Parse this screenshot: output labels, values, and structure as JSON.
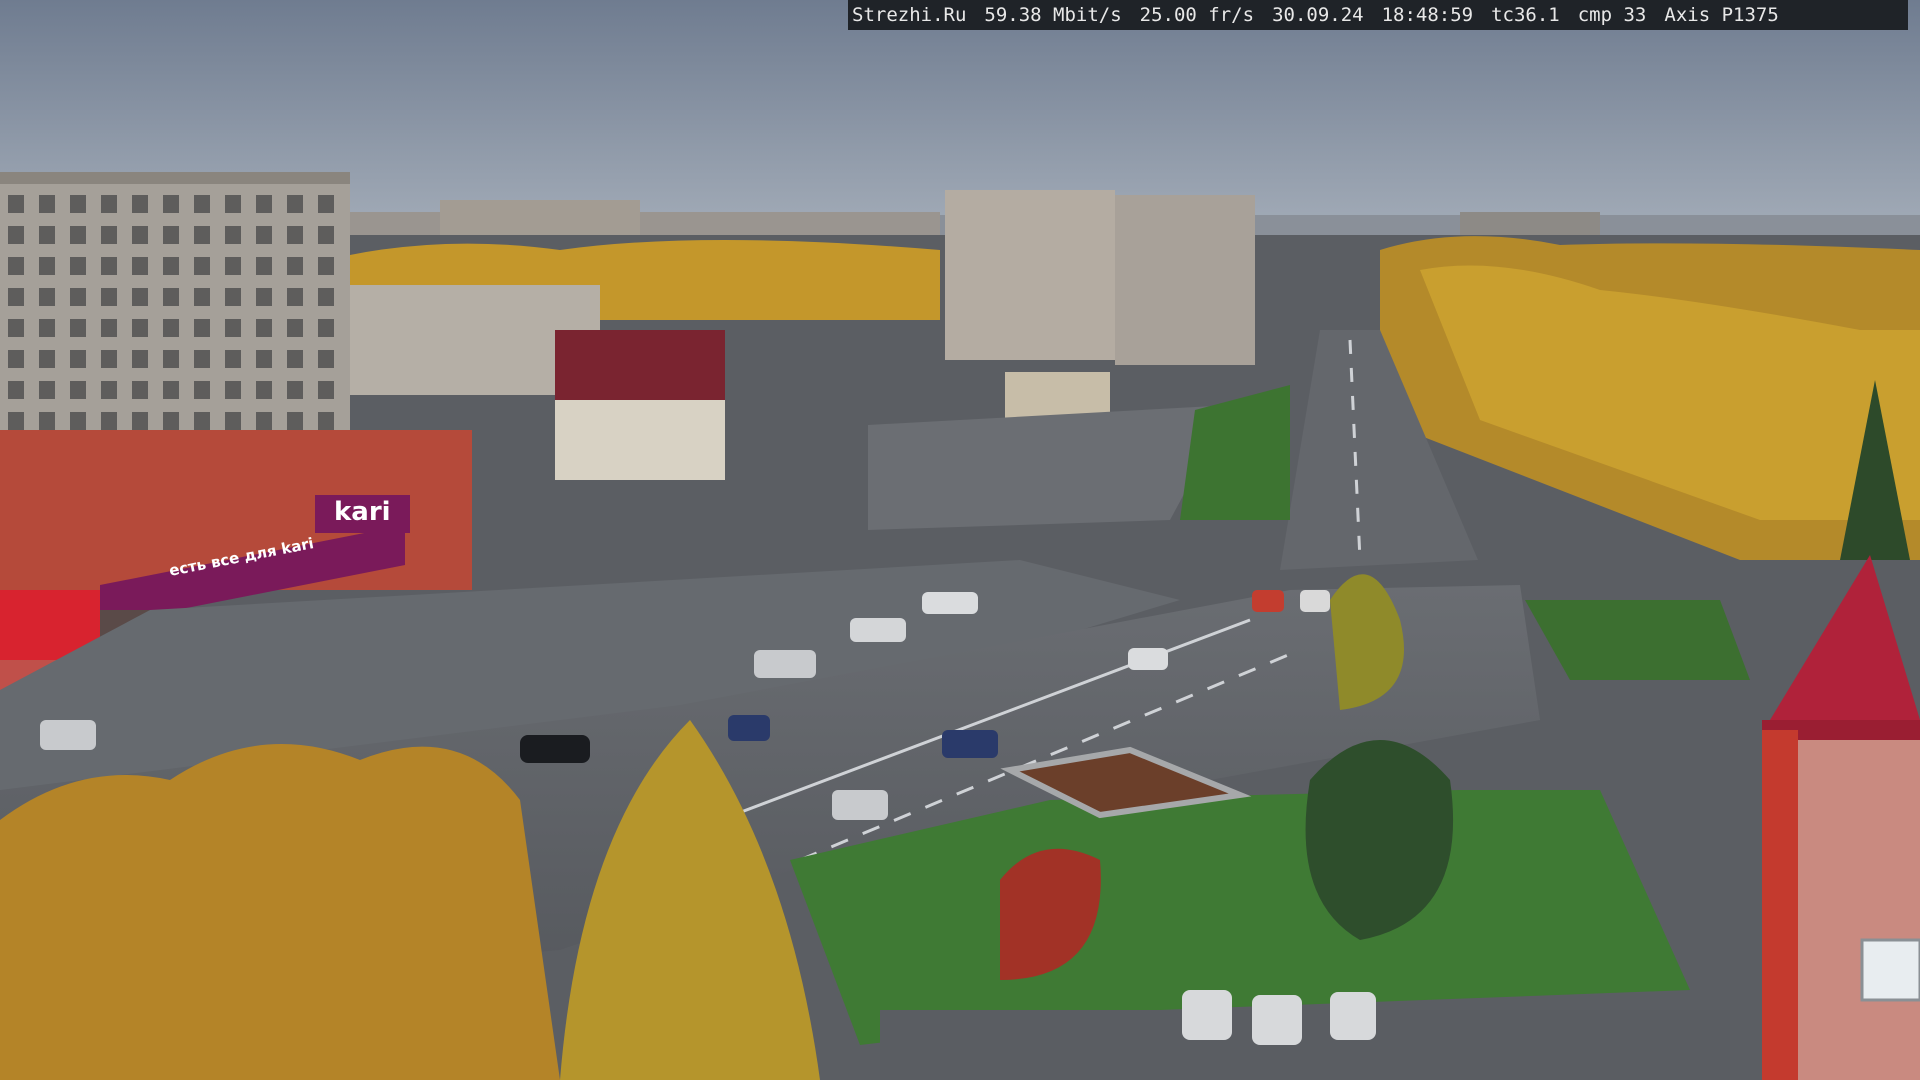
{
  "overlay": {
    "site": "Strezhi.Ru",
    "bitrate": "59.38 Mbit/s",
    "framerate": "25.00 fr/s",
    "date": "30.09.24",
    "time": "18:48:59",
    "tc": "tc36.1",
    "cmp": "cmp 33",
    "camera": "Axis P1375"
  },
  "signs": {
    "store_logo": "kari",
    "store_banner": "есть все для kari"
  },
  "colors": {
    "sky": "#7e8a9c",
    "asphalt": "#55585d",
    "grass": "#3f7a34",
    "autumn_foliage": "#c89a2a",
    "store_facade": "#b54a3a",
    "store_banner": "#7a1a5a",
    "tower_roof": "#b0223a",
    "osd_background": "#1f2328"
  }
}
